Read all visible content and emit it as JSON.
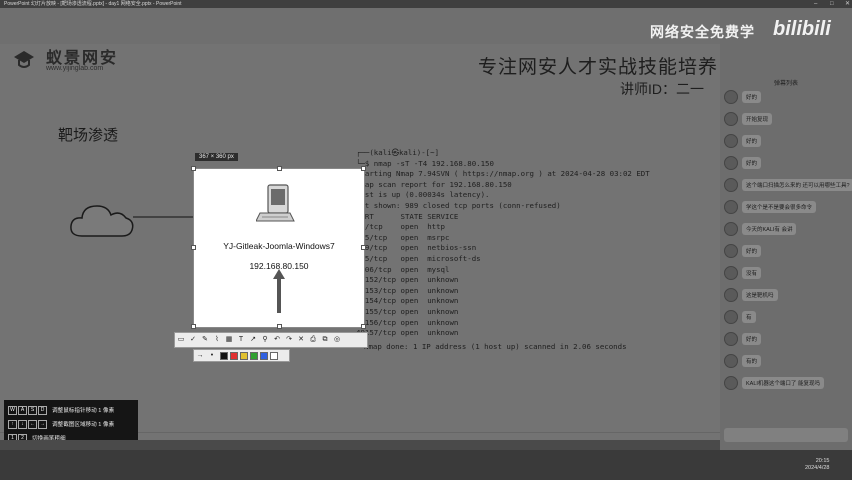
{
  "window": {
    "title": "PowerPoint 幻灯片放映 - [靶场渗透流程.pptx] - day1 网络安全.pptx - PowerPoint"
  },
  "slide": {
    "logo_text": "蚁景网安",
    "logo_url": "www.yijinglab.com",
    "slogan": "专注网安人才实战技能培养",
    "teacher": "讲师ID：二一",
    "section_title": "靶场渗透",
    "terminal_lines": [
      "┌──(kali㉿kali)-[~]",
      "└─$ nmap -sT -T4 192.168.80.150",
      "Starting Nmap 7.94SVN ( https://nmap.org ) at 2024-04-28 03:02 EDT",
      "Nmap scan report for 192.168.80.150",
      "Host is up (0.00034s latency).",
      "Not shown: 989 closed tcp ports (conn-refused)",
      "PORT      STATE SERVICE",
      "80/tcp    open  http",
      "135/tcp   open  msrpc",
      "139/tcp   open  netbios-ssn",
      "445/tcp   open  microsoft-ds",
      "3306/tcp  open  mysql",
      "49152/tcp open  unknown",
      "49153/tcp open  unknown",
      "49154/tcp open  unknown",
      "49155/tcp open  unknown",
      "49156/tcp open  unknown",
      "49157/tcp open  unknown"
    ],
    "terminal_done": "Nmap done: 1 IP address (1 host up) scanned in 2.06 seconds"
  },
  "capture": {
    "size_label": "367 × 360 px",
    "host_name": "YJ-Gitleak-Joomla-Windows7",
    "host_ip": "192.168.80.150",
    "toolbar_icons": [
      "rect",
      "ok",
      "pen",
      "brush",
      "mosaic",
      "text",
      "arrow",
      "pin",
      "undo",
      "redo",
      "cancel",
      "save",
      "copy",
      "ocr"
    ],
    "colors": [
      "#111111",
      "#e03030",
      "#e0c030",
      "#30a030",
      "#3060e0",
      "#ffffff"
    ]
  },
  "help": {
    "rows": [
      {
        "keys": [
          "W",
          "A",
          "S",
          "D"
        ],
        "text": "调整鼠标指针移动 1 像素"
      },
      {
        "keys": [
          "↑",
          "↓",
          "←",
          "→"
        ],
        "text": "调整截图区域移动 1 像素"
      },
      {
        "keys": [
          "1",
          "2"
        ],
        "text": "切换画笔粗细"
      },
      {
        "keys": [
          "🖱"
        ],
        "text": "取消选中当前标注"
      },
      {
        "keys": [
          "⇧"
        ],
        "text": "显示/隐藏被截取的鼠标指针"
      }
    ]
  },
  "chat": {
    "title": "弹幕列表",
    "messages": [
      "好的",
      "开始复现",
      "好的",
      "好的",
      "这个端口扫描怎么来的 还可以用哪些工具?",
      "学这个是不是要会很多命令",
      "今天的KALI有 会讲",
      "好的",
      "没有",
      "这是靶机吗",
      "有",
      "好的",
      "有的",
      "KALI机器这个端口了 能复现吗"
    ]
  },
  "watermark": {
    "text": "网络安全免费学",
    "logo": "bilibili"
  },
  "clock": {
    "time": "20:15",
    "date": "2024/4/28"
  }
}
